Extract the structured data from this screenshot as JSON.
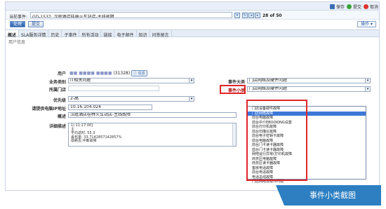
{
  "toolbar": {
    "save": "保存",
    "submit": "提交",
    "cancel": "取消"
  },
  "current_event": {
    "label": "当前事件:",
    "value": "GD-1537: 汉庭酒店桂林火车站店-主线故障",
    "page_indicator": "28 of 50"
  },
  "buttons": {
    "process": "处理",
    "submit": "提交",
    "operation": "操作"
  },
  "tabs": [
    {
      "label": "概述"
    },
    {
      "label": "SLA服务详情"
    },
    {
      "label": "历史"
    },
    {
      "label": "子事件"
    },
    {
      "label": "所有活动"
    },
    {
      "label": "链接"
    },
    {
      "label": "电子邮件"
    },
    {
      "label": "知识"
    },
    {
      "label": "问答留言"
    }
  ],
  "section_title": "用户信息",
  "fields": {
    "user_label": "用户",
    "user_value": "(31328)",
    "user_info_button": "信息",
    "business_type_label": "业务类别",
    "business_type_value": "IT相关问题",
    "store_label": "所属门店",
    "priority_label": "优先级",
    "priority_value": "2-高",
    "ip_label": "请提供电脑IP地址",
    "ip_value": "10.16.104.024",
    "desc_label": "概述",
    "desc_value": "汉庭酒店桂林火车站店-主线故障",
    "detail_label": "详细描述",
    "detail_lines": [
      "1) 11:17:00]",
      "主",
      "平均返时: 55.3",
      "丢包率: 33.7142857142857%",
      "损耗否:中断故障"
    ],
    "event_category_label": "事件大类",
    "event_category_value": "门店网络及硬件问题",
    "event_subcategory_label": "事件小类",
    "event_subcategory_value": "门店网络及硬件问题"
  },
  "dropdown_options": [
    "门店设备硬件故障",
    "门店网络故障",
    "前台电脑故障",
    "前台中介EBOOKING设置",
    "前台打印机故障",
    "前台扫描仪故障",
    "前台电子密钥卡故障",
    "前台电脑故障",
    "前台门卡读卡器故障",
    "前台门卡读卡器故障",
    "网吧运行异常(打印机故障",
    "商务区电脑故障",
    "商务区读卡器故障",
    "客房电话故障",
    "前台电话故障",
    "电话总线故障",
    "门店网络及硬件问题"
  ],
  "dropdown_highlight_index": 1,
  "caption": "事件小类截图"
}
